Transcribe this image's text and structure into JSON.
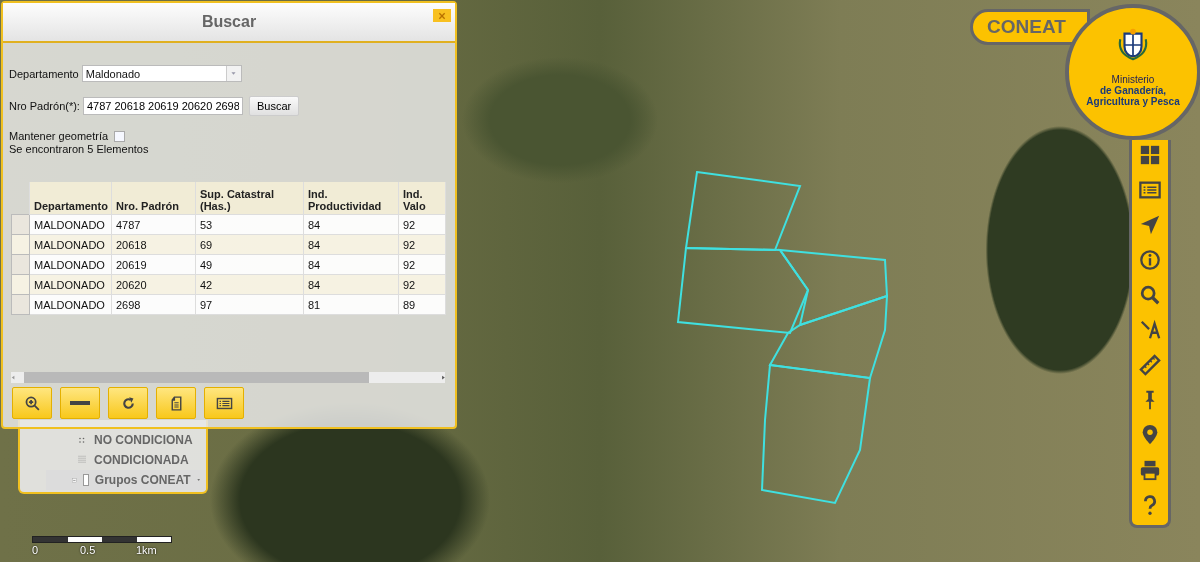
{
  "dialog": {
    "title": "Buscar",
    "departamento": {
      "label": "Departamento",
      "value": "Maldonado"
    },
    "padron": {
      "label": "Nro Padrón(*):",
      "value": "4787 20618 20619 20620 2698",
      "button": "Buscar"
    },
    "keep_geometry": {
      "label": "Mantener geometría",
      "checked": false
    },
    "result_text": "Se encontraron 5 Elementos",
    "table": {
      "columns": [
        "Departamento",
        "Nro. Padrón",
        "Sup. Catastral (Has.)",
        "Ind. Productividad",
        "Ind. Valo"
      ],
      "rows": [
        {
          "selected": false,
          "cells": [
            "MALDONADO",
            "4787",
            "53",
            "84",
            "92"
          ]
        },
        {
          "selected": false,
          "cells": [
            "MALDONADO",
            "20618",
            "69",
            "84",
            "92"
          ]
        },
        {
          "selected": false,
          "cells": [
            "MALDONADO",
            "20619",
            "49",
            "84",
            "92"
          ]
        },
        {
          "selected": false,
          "cells": [
            "MALDONADO",
            "20620",
            "42",
            "84",
            "92"
          ]
        },
        {
          "selected": false,
          "cells": [
            "MALDONADO",
            "2698",
            "97",
            "81",
            "89"
          ]
        }
      ]
    }
  },
  "layer_panel": {
    "legend": [
      {
        "kind": "dots",
        "label": "NO CONDICIONA"
      },
      {
        "kind": "grid",
        "label": "CONDICIONADA"
      }
    ],
    "group": {
      "label": "Grupos CONEAT",
      "checked": false,
      "expanded": true
    }
  },
  "logo": {
    "app_name": "CONEAT",
    "ministry_lines": [
      "Ministerio",
      "de Ganadería,",
      "Agricultura y Pesca"
    ]
  },
  "scale_bar": {
    "labels": [
      "0",
      "0.5",
      "1km"
    ]
  }
}
